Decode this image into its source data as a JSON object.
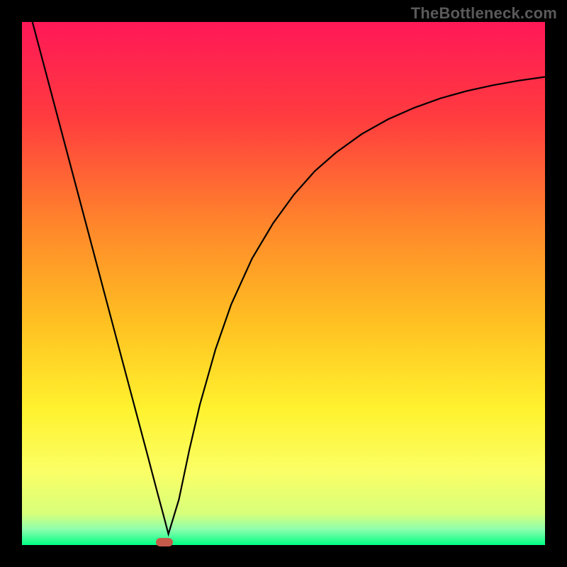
{
  "watermark": {
    "text": "TheBottleneck.com"
  },
  "chart_data": {
    "type": "line",
    "title": "",
    "xlabel": "",
    "ylabel": "",
    "xlim": [
      0,
      100
    ],
    "ylim": [
      0,
      100
    ],
    "grid": false,
    "legend": false,
    "background_gradient": {
      "stops": [
        {
          "pct": 0,
          "color": "#ff1857"
        },
        {
          "pct": 18,
          "color": "#ff3b3f"
        },
        {
          "pct": 40,
          "color": "#ff8a2a"
        },
        {
          "pct": 58,
          "color": "#ffc222"
        },
        {
          "pct": 74,
          "color": "#fff22e"
        },
        {
          "pct": 86,
          "color": "#fbff66"
        },
        {
          "pct": 94,
          "color": "#d7ff7a"
        },
        {
          "pct": 97,
          "color": "#8dffad"
        },
        {
          "pct": 100,
          "color": "#00ff85"
        }
      ]
    },
    "series": [
      {
        "name": "bottleneck-curve",
        "color": "#000000",
        "width": 2.2,
        "x": [
          2,
          5,
          8,
          11,
          14,
          17,
          20,
          22,
          24,
          25,
          26,
          27,
          28,
          30,
          32,
          34,
          37,
          40,
          44,
          48,
          52,
          56,
          60,
          65,
          70,
          75,
          80,
          85,
          90,
          95,
          100
        ],
        "y": [
          100,
          88.7,
          77.4,
          66.1,
          54.8,
          43.5,
          32.2,
          24.7,
          17.2,
          13.4,
          9.6,
          5.9,
          2.1,
          8.7,
          18.2,
          26.8,
          37.4,
          46.0,
          54.8,
          61.5,
          67.0,
          71.5,
          75.0,
          78.6,
          81.4,
          83.6,
          85.4,
          86.8,
          87.9,
          88.8,
          89.5
        ]
      }
    ],
    "marker": {
      "name": "optimal-point",
      "x": 27.3,
      "y": 0.6,
      "color": "#c55a4a"
    }
  }
}
